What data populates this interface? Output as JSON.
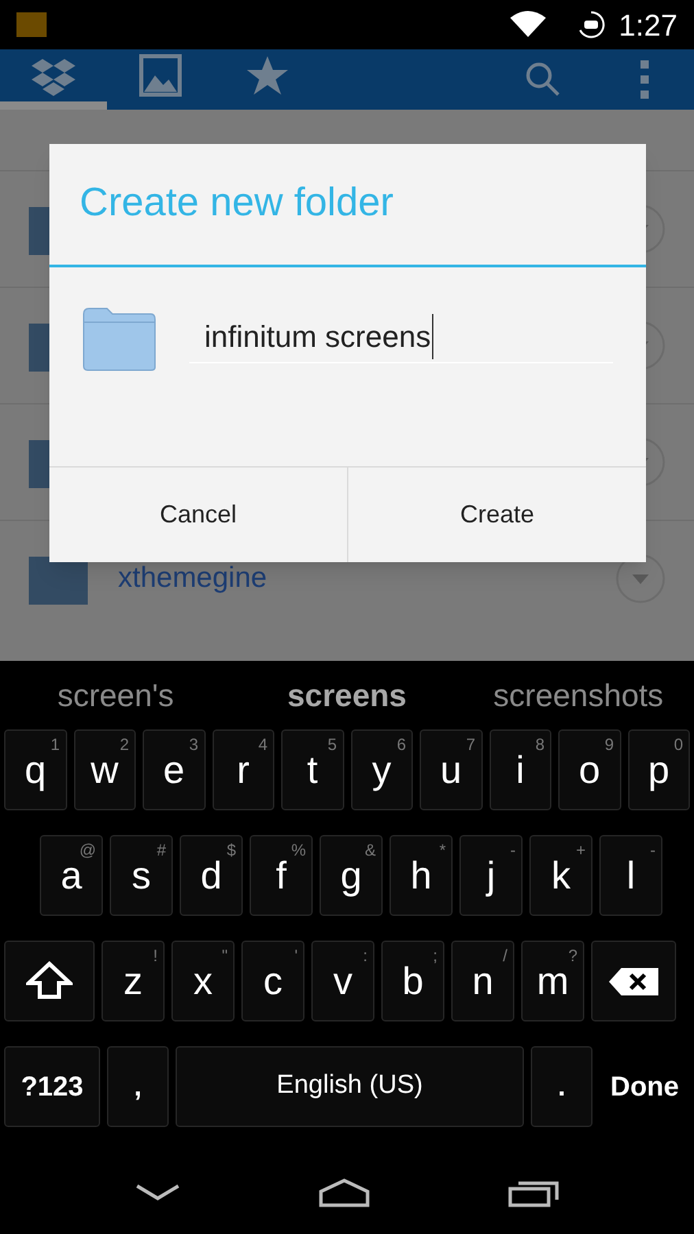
{
  "status_bar": {
    "time": "1:27"
  },
  "action_bar": {
    "tabs": [
      {
        "kind": "dropbox",
        "selected": true
      },
      {
        "kind": "photos",
        "selected": false
      },
      {
        "kind": "favorites",
        "selected": false
      }
    ]
  },
  "folders": [
    {
      "kind": "folder"
    },
    {
      "kind": "folder"
    },
    {
      "kind": "folder"
    },
    {
      "kind": "folder",
      "name": "xthemegine"
    }
  ],
  "dialog": {
    "title": "Create new folder",
    "folder_name": "infinitum screens",
    "buttons": [
      "Cancel",
      "Create"
    ]
  },
  "keyboard": {
    "suggestions": [
      {
        "text": "screen's",
        "selected": false
      },
      {
        "text": "screens",
        "selected": true
      },
      {
        "text": "screenshots",
        "selected": false
      }
    ],
    "letter_rows": [
      [
        {
          "kind": "char",
          "label": "q",
          "hint": "1"
        },
        {
          "kind": "char",
          "label": "w",
          "hint": "2"
        },
        {
          "kind": "char",
          "label": "e",
          "hint": "3"
        },
        {
          "kind": "char",
          "label": "r",
          "hint": "4"
        },
        {
          "kind": "char",
          "label": "t",
          "hint": "5"
        },
        {
          "kind": "char",
          "label": "y",
          "hint": "6"
        },
        {
          "kind": "char",
          "label": "u",
          "hint": "7"
        },
        {
          "kind": "char",
          "label": "i",
          "hint": "8"
        },
        {
          "kind": "char",
          "label": "o",
          "hint": "9"
        },
        {
          "kind": "char",
          "label": "p",
          "hint": "0"
        }
      ],
      [
        {
          "kind": "char",
          "label": "a",
          "hint": "@"
        },
        {
          "kind": "char",
          "label": "s",
          "hint": "#"
        },
        {
          "kind": "char",
          "label": "d",
          "hint": "$"
        },
        {
          "kind": "char",
          "label": "f",
          "hint": "%"
        },
        {
          "kind": "char",
          "label": "g",
          "hint": "&"
        },
        {
          "kind": "char",
          "label": "h",
          "hint": "*"
        },
        {
          "kind": "char",
          "label": "j",
          "hint": "-"
        },
        {
          "kind": "char",
          "label": "k",
          "hint": "+"
        },
        {
          "kind": "char",
          "label": "l",
          "hint": "-"
        }
      ],
      [
        {
          "kind": "shift"
        },
        {
          "kind": "char",
          "label": "z",
          "hint": "!"
        },
        {
          "kind": "char",
          "label": "x",
          "hint": "\""
        },
        {
          "kind": "char",
          "label": "c",
          "hint": "'"
        },
        {
          "kind": "char",
          "label": "v",
          "hint": ":"
        },
        {
          "kind": "char",
          "label": "b",
          "hint": ";"
        },
        {
          "kind": "char",
          "label": "n",
          "hint": "/"
        },
        {
          "kind": "char",
          "label": "m",
          "hint": "?"
        },
        {
          "kind": "delete"
        }
      ]
    ],
    "bottom_row": {
      "mode_key": "?123",
      "comma_key": ",",
      "space_bar": "English (US)",
      "period_key": ".",
      "action_key": "Done"
    }
  }
}
